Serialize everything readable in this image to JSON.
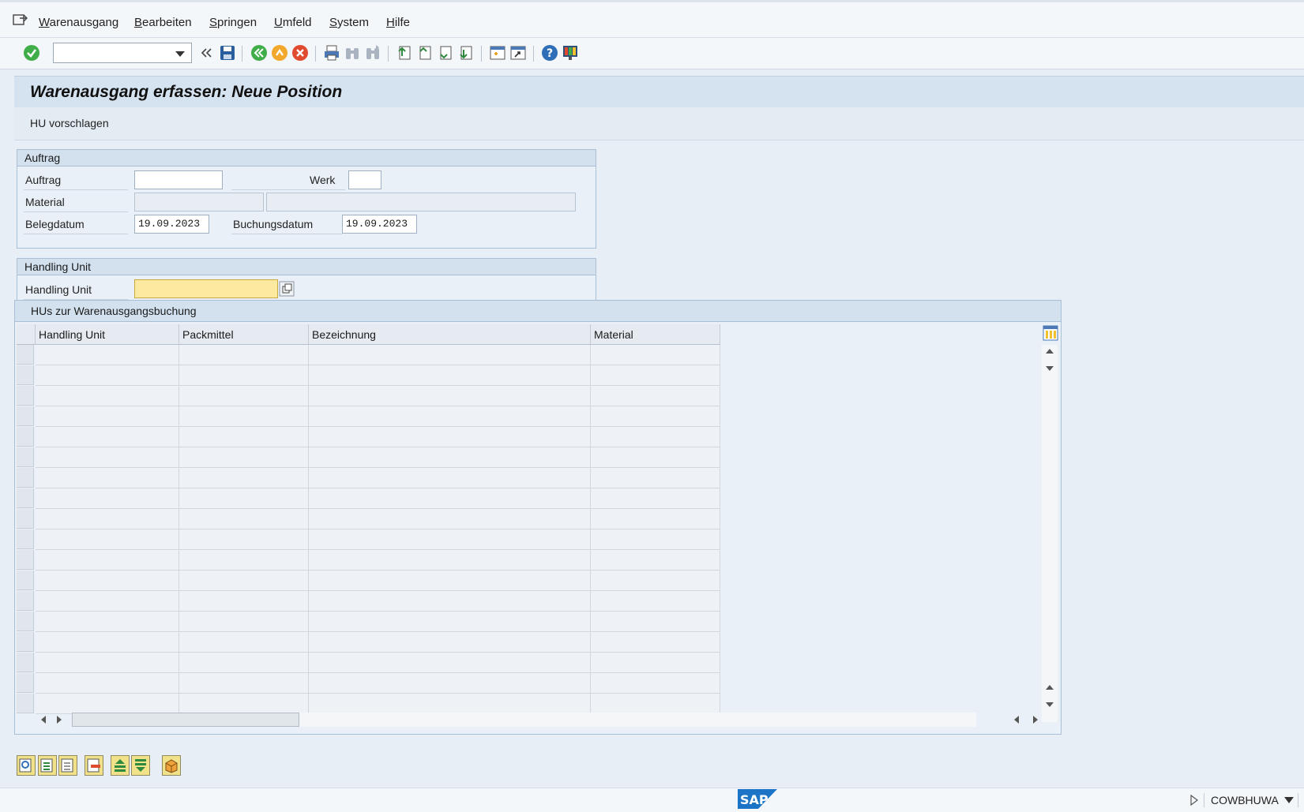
{
  "menu": {
    "items": [
      "Warenausgang",
      "Bearbeiten",
      "Springen",
      "Umfeld",
      "System",
      "Hilfe"
    ]
  },
  "toolbar": {
    "command_field_value": "",
    "icons": [
      "enter-icon",
      "back-double-icon",
      "save-icon",
      "back-icon",
      "exit-icon",
      "cancel-icon",
      "print-icon",
      "find-icon",
      "find-next-icon",
      "first-page-icon",
      "previous-page-icon",
      "next-page-icon",
      "last-page-icon",
      "new-session-icon",
      "shortcut-icon",
      "help-icon",
      "customize-layout-icon"
    ]
  },
  "screen": {
    "title": "Warenausgang erfassen: Neue Position",
    "app_toolbar_button": "HU vorschlagen"
  },
  "auftrag_group": {
    "header": "Auftrag",
    "auftrag_label": "Auftrag",
    "auftrag_value": "",
    "werk_label": "Werk",
    "werk_value": "",
    "material_label": "Material",
    "material_value": "",
    "material_desc": "",
    "belegdatum_label": "Belegdatum",
    "belegdatum_value": "19.09.2023",
    "buchungsdatum_label": "Buchungsdatum",
    "buchungsdatum_value": "19.09.2023"
  },
  "hu_group": {
    "header": "Handling Unit",
    "hu_label": "Handling Unit",
    "hu_value": ""
  },
  "hu_table": {
    "title": "HUs zur Warenausgangsbuchung",
    "columns": [
      "Handling Unit",
      "Packmittel",
      "Bezeichnung",
      "Material"
    ],
    "rows": []
  },
  "statusbar": {
    "logo": "SAP",
    "system": "COWBHUWA"
  }
}
